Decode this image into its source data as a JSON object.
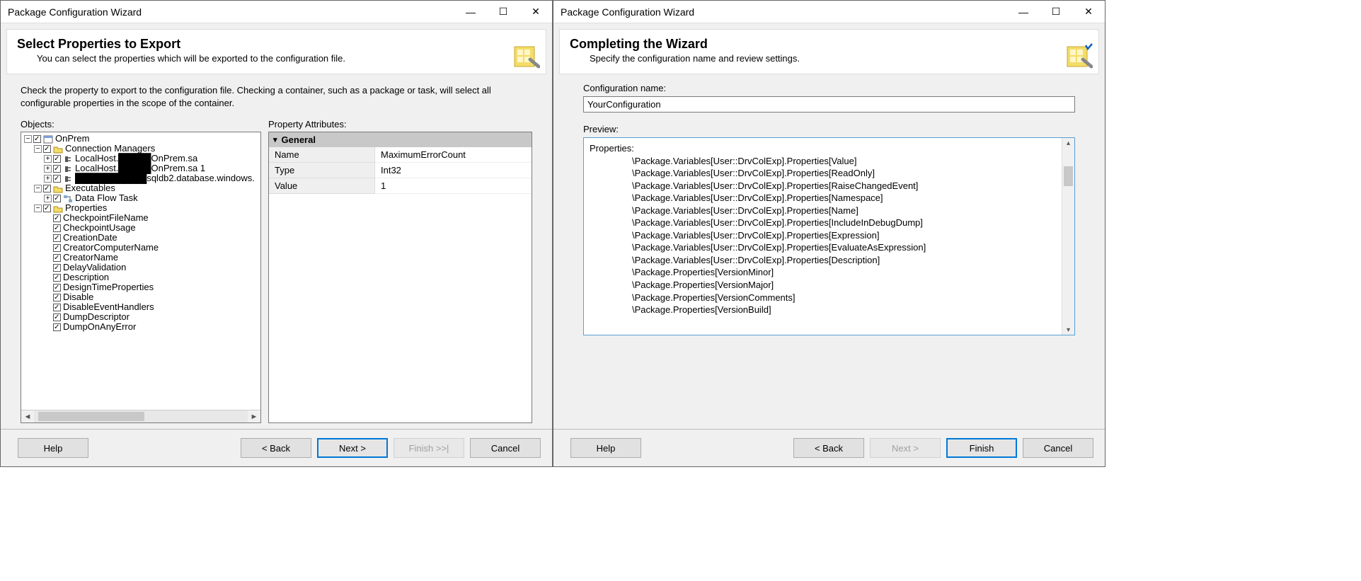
{
  "left": {
    "windowTitle": "Package Configuration Wizard",
    "heading": "Select Properties to Export",
    "subtitle": "You can select the properties which will be exported to the configuration file.",
    "instruction": "Check the property to export to the configuration file. Checking a container, such as a package or task, will select all configurable properties in the scope of the container.",
    "objectsLabel": "Objects:",
    "propertyAttributesLabel": "Property Attributes:",
    "tree": {
      "root": "OnPrem",
      "connMgr": "Connection Managers",
      "cm1_a": "LocalHost.",
      "cm1_b": "OnPrem.sa",
      "cm2_a": "LocalHost.",
      "cm2_b": "OnPrem.sa 1",
      "cm3_b": "sqldb2.database.windows.",
      "execLabel": "Executables",
      "dft": "Data Flow Task",
      "propsLabel": "Properties",
      "props": [
        "CheckpointFileName",
        "CheckpointUsage",
        "CreationDate",
        "CreatorComputerName",
        "CreatorName",
        "DelayValidation",
        "Description",
        "DesignTimeProperties",
        "Disable",
        "DisableEventHandlers",
        "DumpDescriptor",
        "DumpOnAnyError"
      ]
    },
    "attr": {
      "section": "General",
      "rows": [
        {
          "name": "Name",
          "value": "MaximumErrorCount"
        },
        {
          "name": "Type",
          "value": "Int32"
        },
        {
          "name": "Value",
          "value": "1"
        }
      ]
    },
    "buttons": {
      "help": "Help",
      "back": "< Back",
      "next": "Next >",
      "finish": "Finish >>|",
      "cancel": "Cancel"
    }
  },
  "right": {
    "windowTitle": "Package Configuration Wizard",
    "heading": "Completing the Wizard",
    "subtitle": "Specify the configuration name and review settings.",
    "configNameLabel": "Configuration name:",
    "configNameValue": "YourConfiguration",
    "previewLabel": "Preview:",
    "previewHeader": "Properties:",
    "previewLines": [
      "\\Package.Variables[User::DrvColExp].Properties[Value]",
      "\\Package.Variables[User::DrvColExp].Properties[ReadOnly]",
      "\\Package.Variables[User::DrvColExp].Properties[RaiseChangedEvent]",
      "\\Package.Variables[User::DrvColExp].Properties[Namespace]",
      "\\Package.Variables[User::DrvColExp].Properties[Name]",
      "\\Package.Variables[User::DrvColExp].Properties[IncludeInDebugDump]",
      "\\Package.Variables[User::DrvColExp].Properties[Expression]",
      "\\Package.Variables[User::DrvColExp].Properties[EvaluateAsExpression]",
      "\\Package.Variables[User::DrvColExp].Properties[Description]",
      "\\Package.Properties[VersionMinor]",
      "\\Package.Properties[VersionMajor]",
      "\\Package.Properties[VersionComments]",
      "\\Package.Properties[VersionBuild]"
    ],
    "buttons": {
      "help": "Help",
      "back": "< Back",
      "next": "Next >",
      "finish": "Finish",
      "cancel": "Cancel"
    }
  }
}
